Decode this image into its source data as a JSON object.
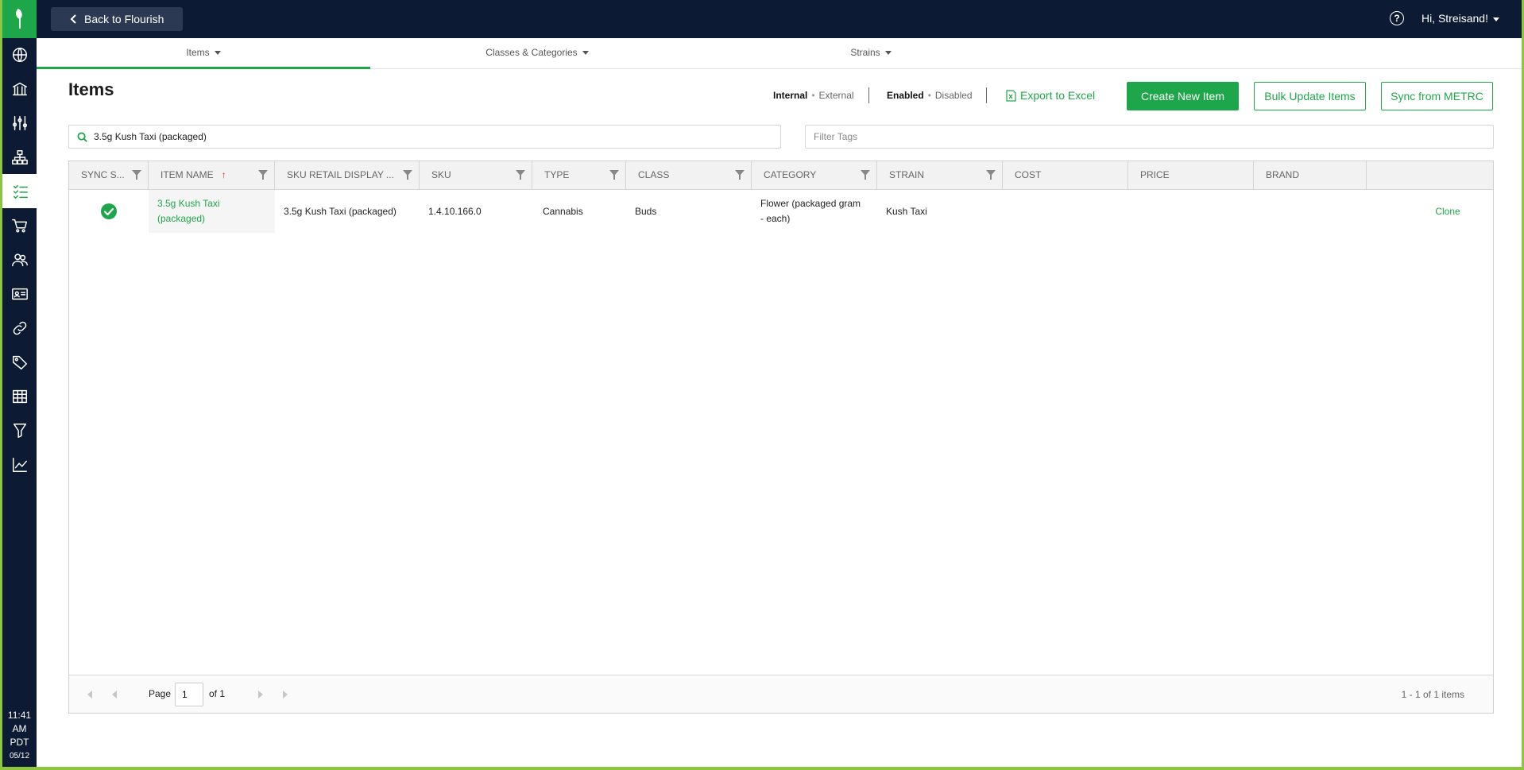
{
  "topbar": {
    "back_label": "Back to Flourish",
    "help_label": "?",
    "user_label": "Hi, Streisand!"
  },
  "clock": {
    "time": "11:41",
    "ampm": "AM",
    "tz": "PDT",
    "date": "05/12"
  },
  "tabs": [
    {
      "label": "Items"
    },
    {
      "label": "Classes & Categories"
    },
    {
      "label": "Strains"
    }
  ],
  "page": {
    "title": "Items"
  },
  "toggles": {
    "scope": {
      "active": "Internal",
      "inactive": "External"
    },
    "status": {
      "active": "Enabled",
      "inactive": "Disabled"
    }
  },
  "actions": {
    "export": "Export to Excel",
    "create": "Create New Item",
    "bulk_update": "Bulk Update Items",
    "sync": "Sync from METRC"
  },
  "search": {
    "value": "3.5g Kush Taxi (packaged)",
    "tags_placeholder": "Filter Tags"
  },
  "table": {
    "columns": [
      "SYNC S...",
      "ITEM NAME",
      "SKU RETAIL DISPLAY ...",
      "SKU",
      "TYPE",
      "CLASS",
      "CATEGORY",
      "STRAIN",
      "COST",
      "PRICE",
      "BRAND"
    ],
    "sort_indicator": "↑",
    "rows": [
      {
        "item_name": "3.5g Kush Taxi (packaged)",
        "sku_retail_display": "3.5g Kush Taxi (packaged)",
        "sku": "1.4.10.166.0",
        "type": "Cannabis",
        "class": "Buds",
        "category": "Flower (packaged gram - each)",
        "strain": "Kush Taxi",
        "cost": "",
        "price": "",
        "brand": "",
        "action": "Clone"
      }
    ]
  },
  "pager": {
    "page_label": "Page",
    "page_value": "1",
    "of_label": "of 1",
    "summary": "1 - 1 of 1 items"
  },
  "colors": {
    "brand_green": "#1ea64a",
    "nav_bg": "#0d1a33",
    "frame_green": "#8cc63f"
  }
}
